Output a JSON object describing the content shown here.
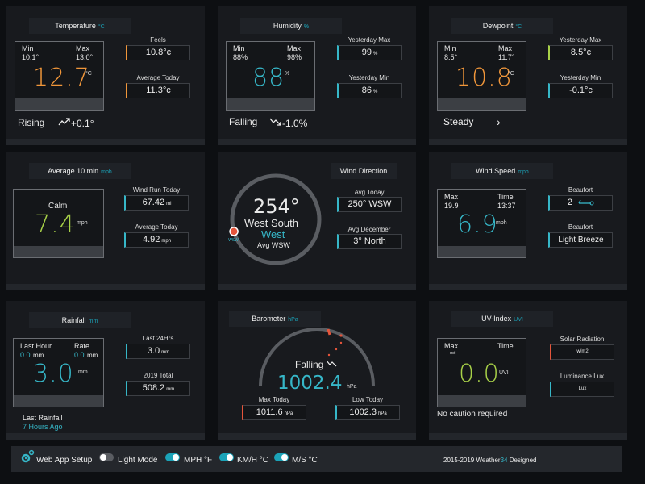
{
  "temperature": {
    "title": "Temperature",
    "unit": "°C",
    "min_label": "Min",
    "min_value": "10.1°",
    "max_label": "Max",
    "max_value": "13.0°",
    "current": "12.7",
    "current_unit": "°C",
    "feels_label": "Feels",
    "feels_value": "10.8°c",
    "avg_label": "Average Today",
    "avg_value": "11.3°c",
    "trend_label": "Rising",
    "trend_value": "+0.1°"
  },
  "humidity": {
    "title": "Humidity",
    "unit": "%",
    "min_label": "Min",
    "min_value": "88%",
    "max_label": "Max",
    "max_value": "98%",
    "current": "88",
    "current_unit": "%",
    "ymax_label": "Yesterday Max",
    "ymax_value": "99",
    "ymin_label": "Yesterday Min",
    "ymin_value": "86",
    "pct": "%",
    "trend_label": "Falling",
    "trend_value": "-1.0%"
  },
  "dewpoint": {
    "title": "Dewpoint",
    "unit": "°C",
    "min_label": "Min",
    "min_value": "8.5°",
    "max_label": "Max",
    "max_value": "11.7°",
    "current": "10.8",
    "current_unit": "°C",
    "ymax_label": "Yesterday Max",
    "ymax_value": "8.5°c",
    "ymin_label": "Yesterday Min",
    "ymin_value": "-0.1°c",
    "trend_label": "Steady",
    "trend_value": "›"
  },
  "avgwind": {
    "title": "Average 10 min",
    "unit": "mph",
    "state": "Calm",
    "current": "7.4",
    "current_unit": "mph",
    "run_label": "Wind Run Today",
    "run_value": "67.42",
    "run_unit": "mi",
    "avg_label": "Average Today",
    "avg_value": "4.92",
    "avg_unit": "mph"
  },
  "winddir": {
    "title": "Wind Direction",
    "degrees": "254°",
    "line1": "West South",
    "line2": "West",
    "line3": "Avg WSW",
    "marker": "WSW",
    "avg_today_label": "Avg Today",
    "avg_today_value": "250°  WSW",
    "avg_month_label": "Avg December",
    "avg_month_value": "3°  North",
    "needle_deg": 254
  },
  "windspeed": {
    "title": "Wind Speed",
    "unit": "mph",
    "max_label": "Max",
    "max_value": "19.9",
    "time_label": "Time",
    "time_value": "13:37",
    "current": "6.9",
    "current_unit": "mph",
    "beaufort_label": "Beaufort",
    "beaufort_value": "2",
    "beaufort_desc_label": "Beaufort",
    "beaufort_desc": "Light Breeze"
  },
  "rainfall": {
    "title": "Rainfall",
    "unit": "mm",
    "last_hour_label": "Last Hour",
    "last_hour_value": "0.0",
    "last_hour_unit": "mm",
    "rate_label": "Rate",
    "rate_value": "0.0",
    "rate_unit": "mm",
    "current": "3.0",
    "current_unit": "mm",
    "h24_label": "Last 24Hrs",
    "h24_value": "3.0",
    "h24_unit": "mm",
    "year_label": "2019 Total",
    "year_value": "508.2",
    "year_unit": "mm",
    "last_rain_label": "Last Rainfall",
    "last_rain_value": "7 Hours Ago"
  },
  "barometer": {
    "title": "Barometer",
    "unit": "hPa",
    "trend": "Falling",
    "current": "1002.4",
    "current_unit": "hPa",
    "max_label": "Max Today",
    "max_value": "1011.6",
    "max_unit": "hPa",
    "low_label": "Low Today",
    "low_value": "1002.3",
    "low_unit": "hPa"
  },
  "uv": {
    "title": "UV-Index",
    "unit": "UVI",
    "max_label": "Max",
    "max_sub": "uvi",
    "time_label": "Time",
    "current": "0.0",
    "current_unit": "UVI",
    "solar_label": "Solar Radiation",
    "solar_unit": "w/m2",
    "lux_label": "Luminance Lux",
    "lux_unit": "Lux",
    "caution": "No caution required"
  },
  "footer": {
    "setup_label": "Web App Setup",
    "light_mode_label": "Light Mode",
    "mph_label": "MPH °F",
    "kmh_label": "KM/H °C",
    "ms_label": "M/S °C",
    "credit_prefix": "2015-2019 Weather",
    "credit_num": "34",
    "credit_suffix": " Designed"
  },
  "colors": {
    "orange": "#f0963a",
    "teal": "#36b7c8",
    "green": "#a8d148",
    "red": "#e5553b"
  }
}
